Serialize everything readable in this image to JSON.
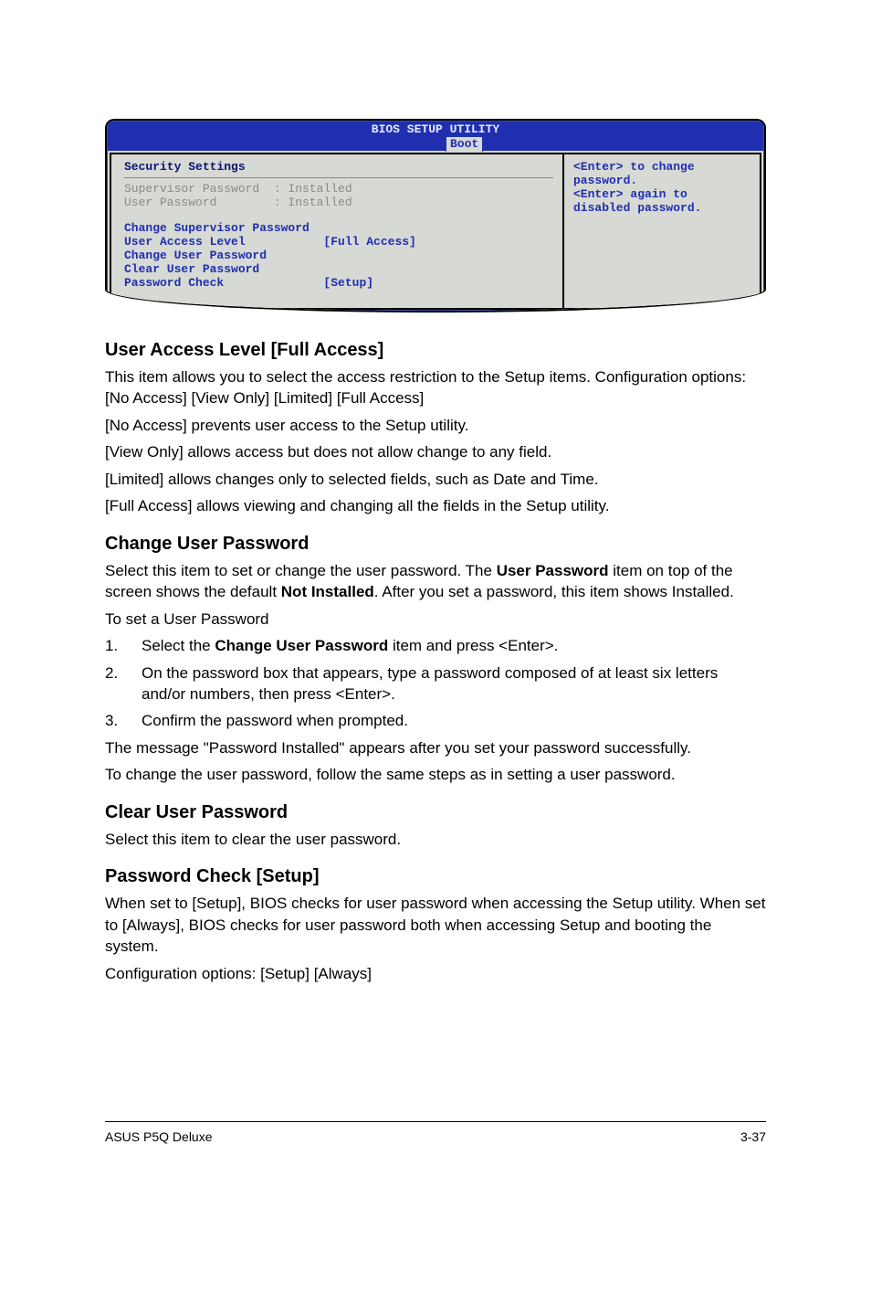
{
  "bios": {
    "title": "BIOS SETUP UTILITY",
    "tab": "Boot",
    "heading": "Security Settings",
    "supervisor_label": "Supervisor Password  : Installed",
    "user_label": "User Password        : Installed",
    "change_supervisor": "Change Supervisor Password",
    "user_access_row": "User Access Level           [Full Access]",
    "change_user": "Change User Password",
    "clear_user": "Clear User Password",
    "password_check_row": "Password Check              [Setup]",
    "help1": "<Enter> to change",
    "help2": "password.",
    "help3": "<Enter> again to",
    "help4": "disabled password."
  },
  "s1": {
    "title": "User Access Level [Full Access]",
    "p1": "This item allows you to select the access restriction to the Setup items. Configuration options: [No Access] [View Only] [Limited] [Full Access]",
    "opt1": "[No Access] prevents user access to the Setup utility.",
    "opt2": "[View Only] allows access but does not allow change to any field.",
    "opt3": "[Limited] allows changes only to selected fields, such as Date and Time.",
    "opt4": "[Full Access] allows viewing and changing all the fields in the Setup utility."
  },
  "s2": {
    "title": "Change User Password",
    "p1a": "Select this item to set or change the user password. The ",
    "p1b": "User Password",
    "p1c": " item on top of the screen shows the default ",
    "p1d": "Not Installed",
    "p1e": ". After you set a password, this item shows Installed.",
    "p2": "To set a User Password",
    "step1a": "Select the ",
    "step1b": "Change User Password",
    "step1c": " item and press <Enter>.",
    "step2": "On the password box that appears, type a password composed of at least six letters and/or numbers, then press <Enter>.",
    "step3": "Confirm the password when prompted.",
    "p3": "The message \"Password Installed\" appears after you set your password successfully.",
    "p4": "To change the user password, follow the same steps as in setting a user password."
  },
  "s3": {
    "title": "Clear User Password",
    "p1": "Select this item to clear the user password."
  },
  "s4": {
    "title": "Password Check [Setup]",
    "p1": "When set to [Setup], BIOS checks for user password when accessing the Setup utility. When set to [Always], BIOS checks for user password both when accessing Setup and booting the system.",
    "p2": "Configuration options: [Setup] [Always]"
  },
  "footer": {
    "left": "ASUS P5Q Deluxe",
    "right": "3-37"
  }
}
